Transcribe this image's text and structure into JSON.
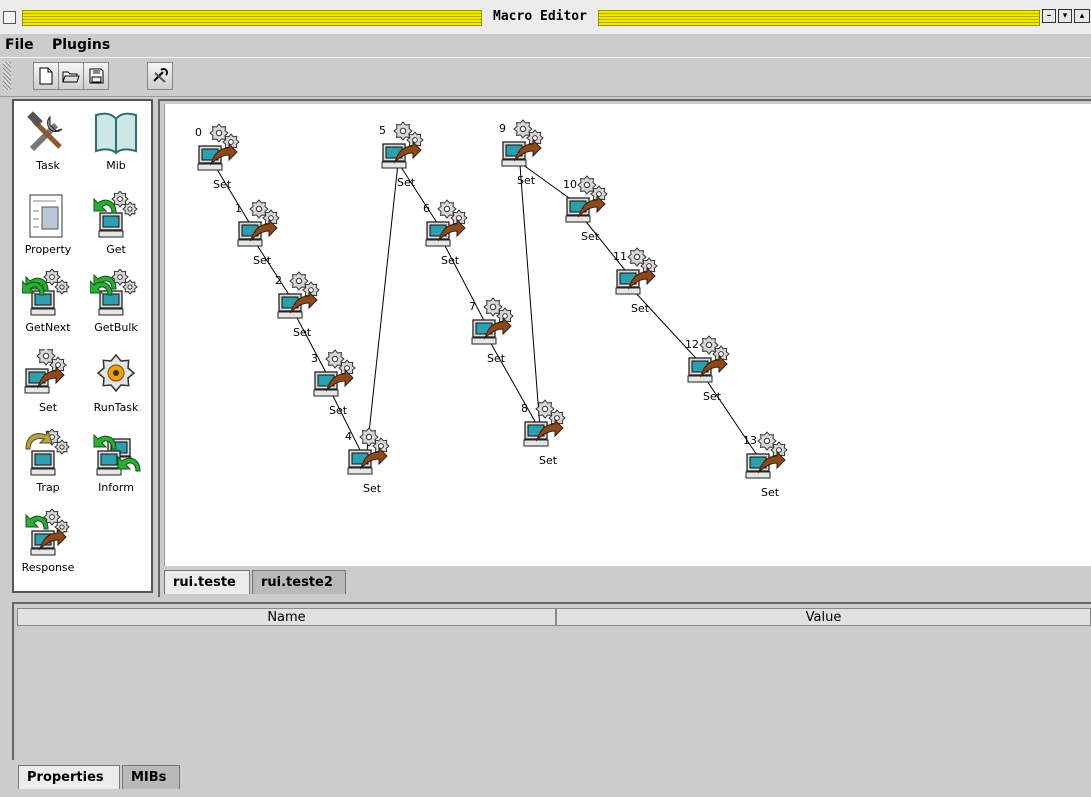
{
  "window": {
    "title": "Macro Editor"
  },
  "menu": {
    "file": "File",
    "plugins": "Plugins"
  },
  "toolbar": {
    "buttons": [
      "new-document-icon",
      "open-folder-icon",
      "save-disk-icon",
      "tools-icon"
    ]
  },
  "palette": {
    "items": [
      {
        "label": "Task",
        "icon": "wrench-hammer-icon"
      },
      {
        "label": "Mib",
        "icon": "book-icon"
      },
      {
        "label": "Property",
        "icon": "property-sheet-icon"
      },
      {
        "label": "Get",
        "icon": "get-computer-icon"
      },
      {
        "label": "GetNext",
        "icon": "getnext-computer-icon"
      },
      {
        "label": "GetBulk",
        "icon": "getbulk-computer-icon"
      },
      {
        "label": "Set",
        "icon": "set-computer-icon"
      },
      {
        "label": "RunTask",
        "icon": "gear-icon"
      },
      {
        "label": "Trap",
        "icon": "trap-computer-icon"
      },
      {
        "label": "Inform",
        "icon": "inform-computer-icon"
      },
      {
        "label": "Response",
        "icon": "response-computer-icon"
      }
    ]
  },
  "canvas": {
    "nodes": [
      {
        "index": "0",
        "label": "Set"
      },
      {
        "index": "1",
        "label": "Set"
      },
      {
        "index": "2",
        "label": "Set"
      },
      {
        "index": "3",
        "label": "Set"
      },
      {
        "index": "4",
        "label": "Set"
      },
      {
        "index": "5",
        "label": "Set"
      },
      {
        "index": "6",
        "label": "Set"
      },
      {
        "index": "7",
        "label": "Set"
      },
      {
        "index": "8",
        "label": "Set"
      },
      {
        "index": "9",
        "label": "Set"
      },
      {
        "index": "10",
        "label": "Set"
      },
      {
        "index": "11",
        "label": "Set"
      },
      {
        "index": "12",
        "label": "Set"
      },
      {
        "index": "13",
        "label": "Set"
      }
    ],
    "tabs": [
      "rui.teste",
      "rui.teste2"
    ],
    "active_tab": "rui.teste"
  },
  "properties": {
    "columns": [
      "Name",
      "Value"
    ],
    "rows": [],
    "tabs": [
      "Properties",
      "MIBs"
    ],
    "active_tab": "Properties"
  }
}
